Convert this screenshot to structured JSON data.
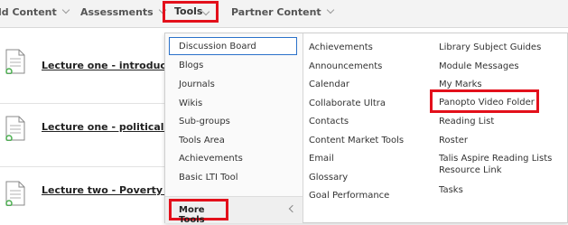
{
  "nav": {
    "build_content": "ld Content",
    "assessments": "Assessments",
    "tools": "Tools",
    "partner_content": "Partner Content"
  },
  "content_rows": [
    {
      "title": "Lecture one - introduct"
    },
    {
      "title": "Lecture one - political i"
    },
    {
      "title": "Lecture two - Poverty a"
    }
  ],
  "tools_menu": {
    "column1": [
      "Discussion Board",
      "Blogs",
      "Journals",
      "Wikis",
      "Sub-groups",
      "Tools Area",
      "Achievements",
      "Basic LTI Tool"
    ],
    "more_tools": "More Tools",
    "column2": [
      "Achievements",
      "Announcements",
      "Calendar",
      "Collaborate Ultra",
      "Contacts",
      "Content Market Tools",
      "Email",
      "Glossary",
      "Goal Performance"
    ],
    "column3": [
      "Library Subject Guides",
      "Module Messages",
      "My Marks",
      "Panopto Video Folder",
      "Reading List",
      "Roster",
      "Talis Aspire Reading Lists",
      "Resource Link",
      "Tasks"
    ]
  },
  "colors": {
    "highlight": "#e3101b",
    "active_border": "#2a71c9",
    "navbar_bg": "#f3f3f3"
  }
}
